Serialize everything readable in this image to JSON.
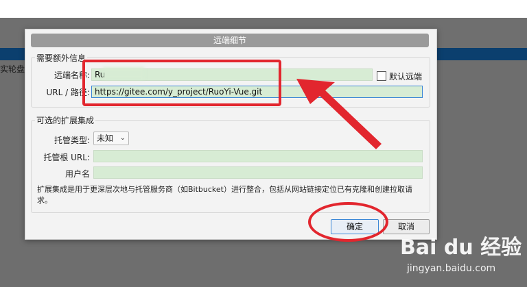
{
  "background": {
    "side_label": "实轮盘"
  },
  "dialog": {
    "title": "远端细节",
    "required_group": {
      "title": "需要额外信息",
      "remote_name_label": "远端名称:",
      "remote_name_value": "Ru",
      "default_remote_label": "默认远端",
      "url_label": "URL / 路径:",
      "url_value": "https://gitee.com/y_project/RuoYi-Vue.git"
    },
    "optional_group": {
      "title": "可选的扩展集成",
      "host_type_label": "托管类型:",
      "host_type_value": "未知",
      "host_root_url_label": "托管根 URL:",
      "host_root_url_value": "",
      "username_label": "用户名",
      "username_value": "",
      "note": "扩展集成是用于更深层次地与托管服务商（如Bitbucket）进行整合，包括从网站链接定位已有克隆和创建拉取请求。"
    },
    "buttons": {
      "ok": "确定",
      "cancel": "取消"
    }
  },
  "watermark": {
    "logo": "Bai du 经验",
    "url": "jingyan.baidu.com"
  },
  "colors": {
    "annotation": "#e2262e",
    "field_bg": "#d7ecd4",
    "focus": "#3a86d6"
  }
}
